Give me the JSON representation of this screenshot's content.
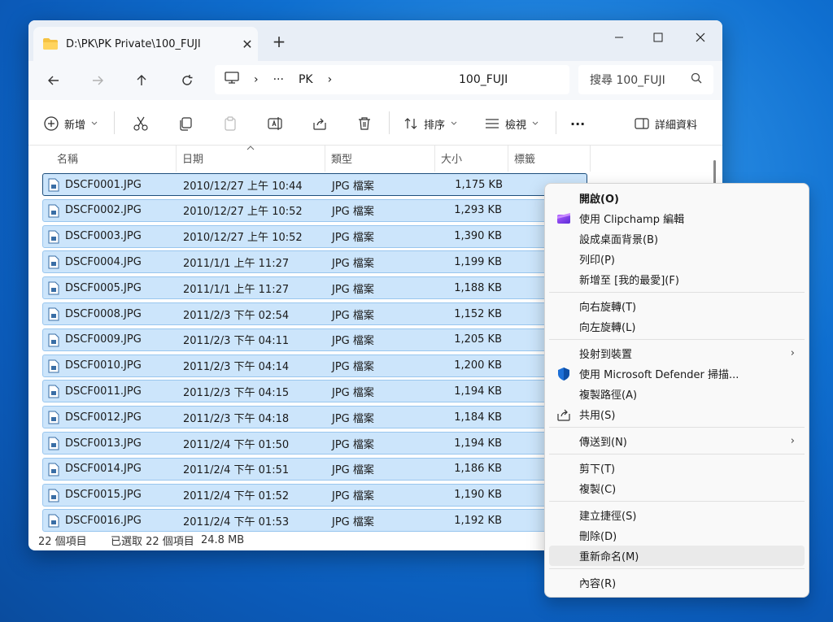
{
  "window": {
    "tab_title": "D:\\PK\\PK Private\\100_FUJI",
    "tab_close": "✕",
    "new_tab": "+",
    "minimize": "—",
    "maximize": "☐",
    "close": "✕"
  },
  "nav": {
    "breadcrumb": [
      "PK",
      "100_FUJI"
    ],
    "breadcrumb_more": "···",
    "sep": "›",
    "search_placeholder": "搜尋 100_FUJI"
  },
  "toolbar": {
    "new_label": "新增",
    "sort_label": "排序",
    "view_label": "檢視",
    "more_label": "···",
    "details_label": "詳細資料"
  },
  "columns": {
    "name": "名稱",
    "date": "日期",
    "type": "類型",
    "size": "大小",
    "tags": "標籤"
  },
  "files": [
    {
      "name": "DSCF0001.JPG",
      "date": "2010/12/27 上午 10:44",
      "type": "JPG 檔案",
      "size": "1,175 KB"
    },
    {
      "name": "DSCF0002.JPG",
      "date": "2010/12/27 上午 10:52",
      "type": "JPG 檔案",
      "size": "1,293 KB"
    },
    {
      "name": "DSCF0003.JPG",
      "date": "2010/12/27 上午 10:52",
      "type": "JPG 檔案",
      "size": "1,390 KB"
    },
    {
      "name": "DSCF0004.JPG",
      "date": "2011/1/1 上午 11:27",
      "type": "JPG 檔案",
      "size": "1,199 KB"
    },
    {
      "name": "DSCF0005.JPG",
      "date": "2011/1/1 上午 11:27",
      "type": "JPG 檔案",
      "size": "1,188 KB"
    },
    {
      "name": "DSCF0008.JPG",
      "date": "2011/2/3 下午 02:54",
      "type": "JPG 檔案",
      "size": "1,152 KB"
    },
    {
      "name": "DSCF0009.JPG",
      "date": "2011/2/3 下午 04:11",
      "type": "JPG 檔案",
      "size": "1,205 KB"
    },
    {
      "name": "DSCF0010.JPG",
      "date": "2011/2/3 下午 04:14",
      "type": "JPG 檔案",
      "size": "1,200 KB"
    },
    {
      "name": "DSCF0011.JPG",
      "date": "2011/2/3 下午 04:15",
      "type": "JPG 檔案",
      "size": "1,194 KB"
    },
    {
      "name": "DSCF0012.JPG",
      "date": "2011/2/3 下午 04:18",
      "type": "JPG 檔案",
      "size": "1,184 KB"
    },
    {
      "name": "DSCF0013.JPG",
      "date": "2011/2/4 下午 01:50",
      "type": "JPG 檔案",
      "size": "1,194 KB"
    },
    {
      "name": "DSCF0014.JPG",
      "date": "2011/2/4 下午 01:51",
      "type": "JPG 檔案",
      "size": "1,186 KB"
    },
    {
      "name": "DSCF0015.JPG",
      "date": "2011/2/4 下午 01:52",
      "type": "JPG 檔案",
      "size": "1,190 KB"
    },
    {
      "name": "DSCF0016.JPG",
      "date": "2011/2/4 下午 01:53",
      "type": "JPG 檔案",
      "size": "1,192 KB"
    }
  ],
  "status": {
    "count": "22 個項目",
    "selected": "已選取 22 個項目",
    "selected_size": "24.8 MB"
  },
  "context_menu": {
    "open": "開啟(O)",
    "clipchamp": "使用 Clipchamp 編輯",
    "wallpaper": "設成桌面背景(B)",
    "print": "列印(P)",
    "favorites": "新增至 [我的最愛](F)",
    "rotate_right": "向右旋轉(T)",
    "rotate_left": "向左旋轉(L)",
    "cast": "投射到裝置",
    "defender": "使用 Microsoft Defender 掃描...",
    "copy_path": "複製路徑(A)",
    "share": "共用(S)",
    "send_to": "傳送到(N)",
    "cut": "剪下(T)",
    "copy": "複製(C)",
    "shortcut": "建立捷徑(S)",
    "delete": "刪除(D)",
    "rename": "重新命名(M)",
    "properties": "內容(R)",
    "submenu_arrow": "›"
  },
  "colors": {
    "selection_fill": "#cce5fb",
    "selection_border": "#99c6ee",
    "accent": "#0067c0",
    "desktop": "#0f6fd0"
  }
}
